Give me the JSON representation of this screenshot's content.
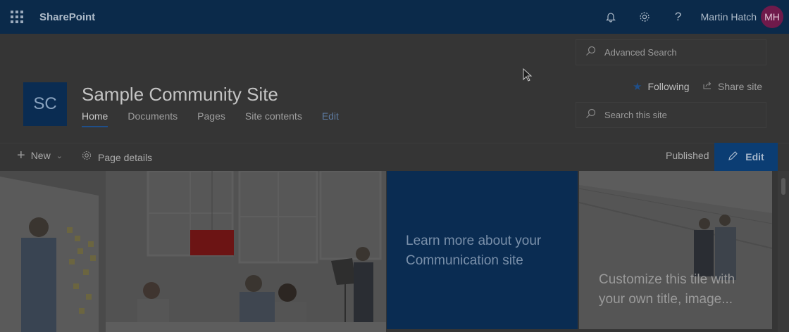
{
  "suitebar": {
    "brand": "SharePoint",
    "user_name": "Martin Hatch",
    "user_initials": "MH",
    "icons": [
      "app-launcher-icon",
      "notification-bell-icon",
      "settings-gear-icon",
      "help-icon"
    ]
  },
  "advanced_search": {
    "placeholder": "Advanced Search"
  },
  "site": {
    "logo_initials": "SC",
    "title": "Sample Community Site",
    "nav": [
      {
        "label": "Home"
      },
      {
        "label": "Documents"
      },
      {
        "label": "Pages"
      },
      {
        "label": "Site contents"
      },
      {
        "label": "Edit"
      }
    ],
    "following_label": "Following",
    "share_label": "Share site",
    "search_placeholder": "Search this site"
  },
  "command_bar": {
    "new_label": "New",
    "page_details_label": "Page details",
    "status": "Published",
    "edit_label": "Edit"
  },
  "hero": {
    "tile_1_text": "Learn more about your Communication site",
    "tile_2_text": "Customize this tile with your own title, image..."
  },
  "colors": {
    "suitebar": "#0b2a4a",
    "accent": "#0a2c52",
    "overlay_background": "#353535"
  }
}
